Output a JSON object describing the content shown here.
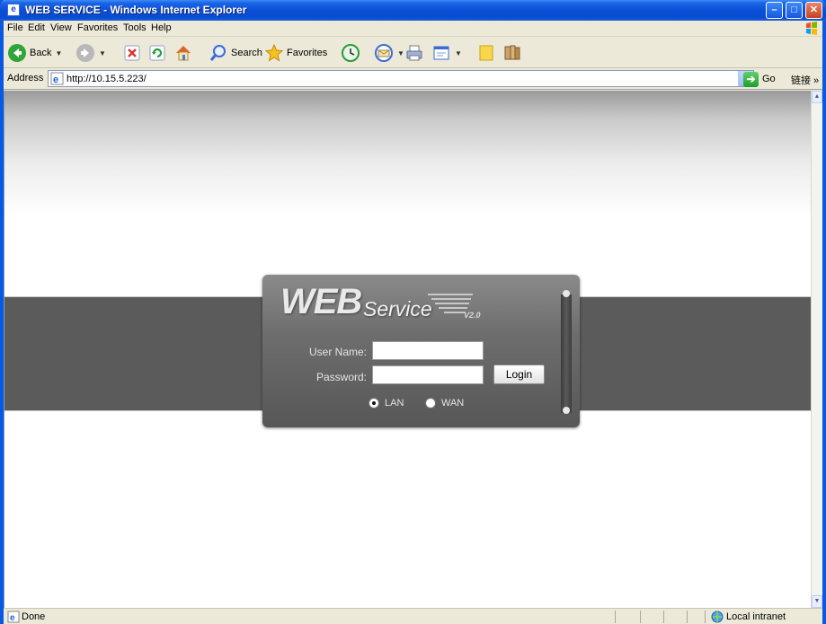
{
  "window": {
    "title": "WEB SERVICE - Windows Internet Explorer",
    "minimize": "–",
    "maximize": "□",
    "close": "✕",
    "app_icon": "e"
  },
  "menu": [
    {
      "label": "File"
    },
    {
      "label": "Edit"
    },
    {
      "label": "View"
    },
    {
      "label": "Favorites"
    },
    {
      "label": "Tools"
    },
    {
      "label": "Help"
    }
  ],
  "toolbar": {
    "back": "Back",
    "search": "Search",
    "favorites": "Favorites",
    "icons": [
      "back-icon",
      "forward-icon",
      "stop-icon",
      "refresh-icon",
      "home-icon",
      "search-icon",
      "favorites-star-icon",
      "history-icon",
      "mail-icon",
      "print-icon",
      "edit-icon",
      "note-icon",
      "research-icon"
    ]
  },
  "address": {
    "label": "Address",
    "url": "http://10.15.5.223/",
    "go": "Go",
    "links": "链接 »"
  },
  "login": {
    "logo_web": "WEB",
    "logo_service": "Service",
    "logo_version": "V2.0",
    "username_label": "User Name:",
    "password_label": "Password:",
    "username_value": "",
    "password_value": "",
    "login_button": "Login",
    "network_options": [
      {
        "label": "LAN",
        "selected": true
      },
      {
        "label": "WAN",
        "selected": false
      }
    ]
  },
  "status": {
    "text": "Done",
    "zone": "Local intranet"
  },
  "colors": {
    "titlebar": "#0a4fd6",
    "band": "#5b5b5b",
    "panel": "#6d6d6d"
  }
}
